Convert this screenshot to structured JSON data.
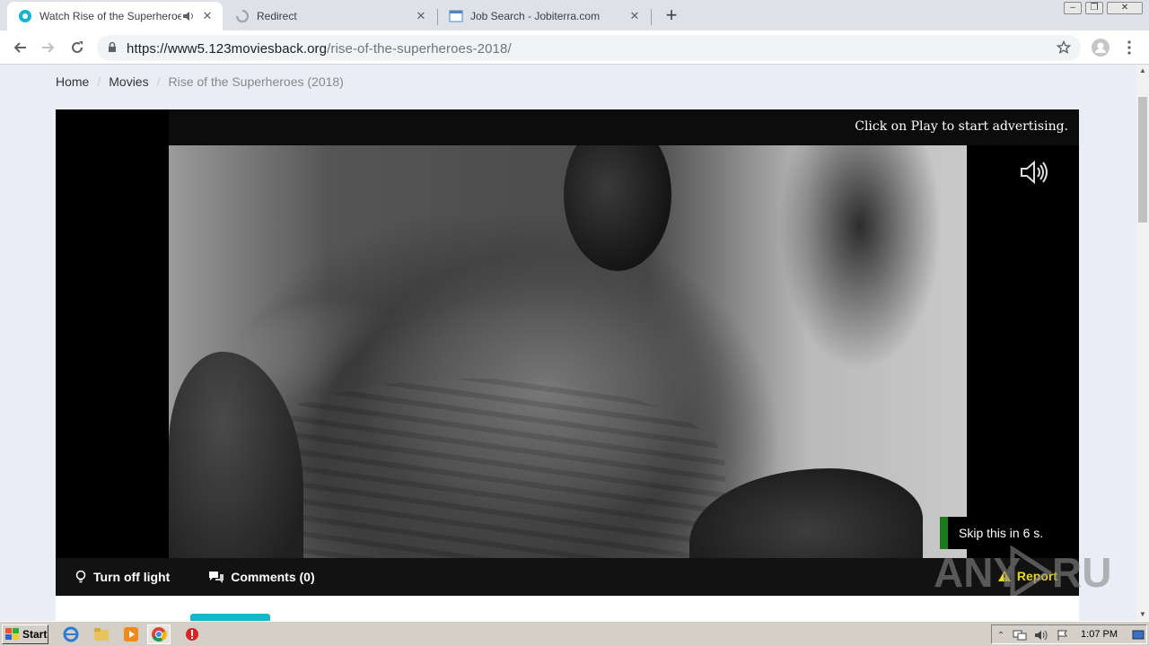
{
  "browser": {
    "tabs": [
      {
        "title": "Watch Rise of the Superheroes",
        "active": true,
        "loading": false,
        "audio": true
      },
      {
        "title": "Redirect",
        "active": false,
        "loading": true,
        "audio": false
      },
      {
        "title": "Job Search - Jobiterra.com",
        "active": false,
        "loading": false,
        "audio": false
      }
    ],
    "new_tab_label": "+",
    "url_host": "https://www5.123moviesback.org",
    "url_path": "/rise-of-the-superheroes-2018/"
  },
  "breadcrumb": {
    "items": [
      "Home",
      "Movies"
    ],
    "current": "Rise of the Superheroes (2018)",
    "separator": "/"
  },
  "player": {
    "ad_notice": "Click on Play to start advertising.",
    "skip_text": "Skip this in 6 s.",
    "controls": {
      "light": "Turn off light",
      "comments": "Comments (0)",
      "report": "Report"
    }
  },
  "watermark": "ANY RUN",
  "taskbar": {
    "start": "Start",
    "clock": "1:07 PM"
  },
  "colors": {
    "accent": "#14b6c9",
    "skip_bar": "#1a7a1a",
    "report": "#e8d82a"
  }
}
